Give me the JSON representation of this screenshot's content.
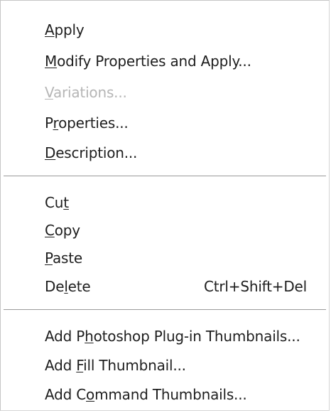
{
  "menu": {
    "group1": [
      {
        "pre": "",
        "key": "A",
        "post": "pply",
        "disabled": false
      },
      {
        "pre": "",
        "key": "M",
        "post": "odify Properties and Apply...",
        "disabled": false
      },
      {
        "pre": "",
        "key": "V",
        "post": "ariations...",
        "disabled": true
      },
      {
        "pre": "P",
        "key": "r",
        "post": "operties...",
        "disabled": false
      },
      {
        "pre": "",
        "key": "D",
        "post": "escription...",
        "disabled": false
      }
    ],
    "group2": [
      {
        "pre": "Cu",
        "key": "t",
        "post": "",
        "disabled": false
      },
      {
        "pre": "",
        "key": "C",
        "post": "opy",
        "disabled": false
      },
      {
        "pre": "",
        "key": "P",
        "post": "aste",
        "disabled": false
      },
      {
        "pre": "De",
        "key": "l",
        "post": "ete",
        "disabled": false,
        "shortcut": "Ctrl+Shift+Del"
      }
    ],
    "group3": [
      {
        "pre": "Add P",
        "key": "h",
        "post": "otoshop Plug-in Thumbnails...",
        "disabled": false
      },
      {
        "pre": "Add ",
        "key": "F",
        "post": "ill Thumbnail...",
        "disabled": false
      },
      {
        "pre": "Add C",
        "key": "o",
        "post": "mmand Thumbnails...",
        "disabled": false
      }
    ]
  },
  "colors": {
    "text": "#1e1e1e",
    "disabled_text": "#b6b6b6",
    "separator": "#9a9a9a",
    "background": "#ffffff"
  }
}
